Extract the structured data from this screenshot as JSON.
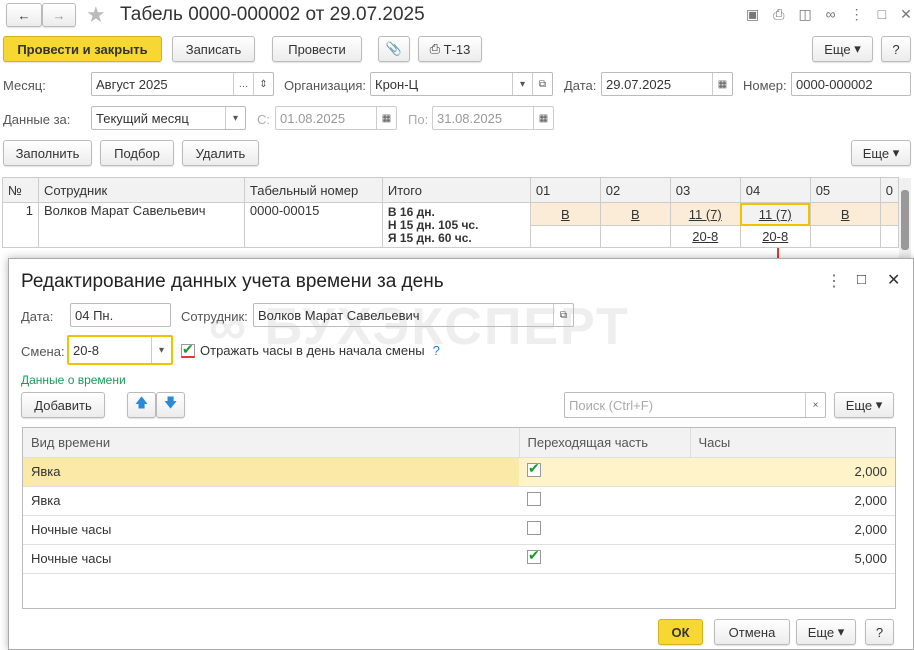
{
  "window": {
    "title": "Табель 0000-000002 от 29.07.2025"
  },
  "toolbar": {
    "post_close": "Провести и закрыть",
    "save": "Записать",
    "post": "Провести",
    "t13": "Т-13",
    "more": "Еще",
    "help": "?"
  },
  "form": {
    "month_label": "Месяц:",
    "month_value": "Август 2025",
    "org_label": "Организация:",
    "org_value": "Крон-Ц",
    "date_label": "Дата:",
    "date_value": "29.07.2025",
    "number_label": "Номер:",
    "number_value": "0000-000002",
    "period_label": "Данные за:",
    "period_value": "Текущий месяц",
    "from_label": "С:",
    "from_value": "01.08.2025",
    "to_label": "По:",
    "to_value": "31.08.2025"
  },
  "actions": {
    "fill": "Заполнить",
    "select": "Подбор",
    "delete": "Удалить",
    "more": "Еще"
  },
  "table": {
    "headers": [
      "№",
      "Сотрудник",
      "Табельный номер",
      "Итого",
      "01",
      "02",
      "03",
      "04",
      "05",
      "0"
    ],
    "rows": [
      {
        "n": "1",
        "employee": "Волков Марат Савельевич",
        "tab_number": "0000-00015",
        "total": [
          "В 16 дн.",
          "Н 15 дн. 105 чс.",
          "Я 15 дн. 60 чс."
        ],
        "days": [
          "В",
          "В",
          "11 (7)",
          "11 (7)",
          "В"
        ],
        "shifts": [
          "",
          "",
          "20-8",
          "20-8",
          ""
        ]
      }
    ]
  },
  "dialog": {
    "title": "Редактирование данных учета времени за день",
    "date_label": "Дата:",
    "date_value": "04 Пн.",
    "employee_label": "Сотрудник:",
    "employee_value": "Волков Марат Савельевич",
    "shift_label": "Смена:",
    "shift_value": "20-8",
    "reflect_label": "Отражать часы в день начала смены",
    "reflect_help": "?",
    "reflect_checked": true,
    "section": "Данные о времени",
    "add": "Добавить",
    "search_placeholder": "Поиск (Ctrl+F)",
    "more": "Еще",
    "columns": [
      "Вид времени",
      "Переходящая часть",
      "Часы"
    ],
    "rows": [
      {
        "type": "Явка",
        "carry": true,
        "hours": "2,000"
      },
      {
        "type": "Явка",
        "carry": false,
        "hours": "2,000"
      },
      {
        "type": "Ночные часы",
        "carry": false,
        "hours": "2,000"
      },
      {
        "type": "Ночные часы",
        "carry": true,
        "hours": "5,000"
      }
    ],
    "ok": "ОК",
    "cancel": "Отмена",
    "more2": "Еще",
    "help": "?",
    "watermark": "БУХЭКСПЕРТ"
  },
  "colors": {
    "accent": "#f7d732",
    "selected_row": "#fbe9a8",
    "weekend": "#fbecd8",
    "section": "#1a9a5a"
  }
}
